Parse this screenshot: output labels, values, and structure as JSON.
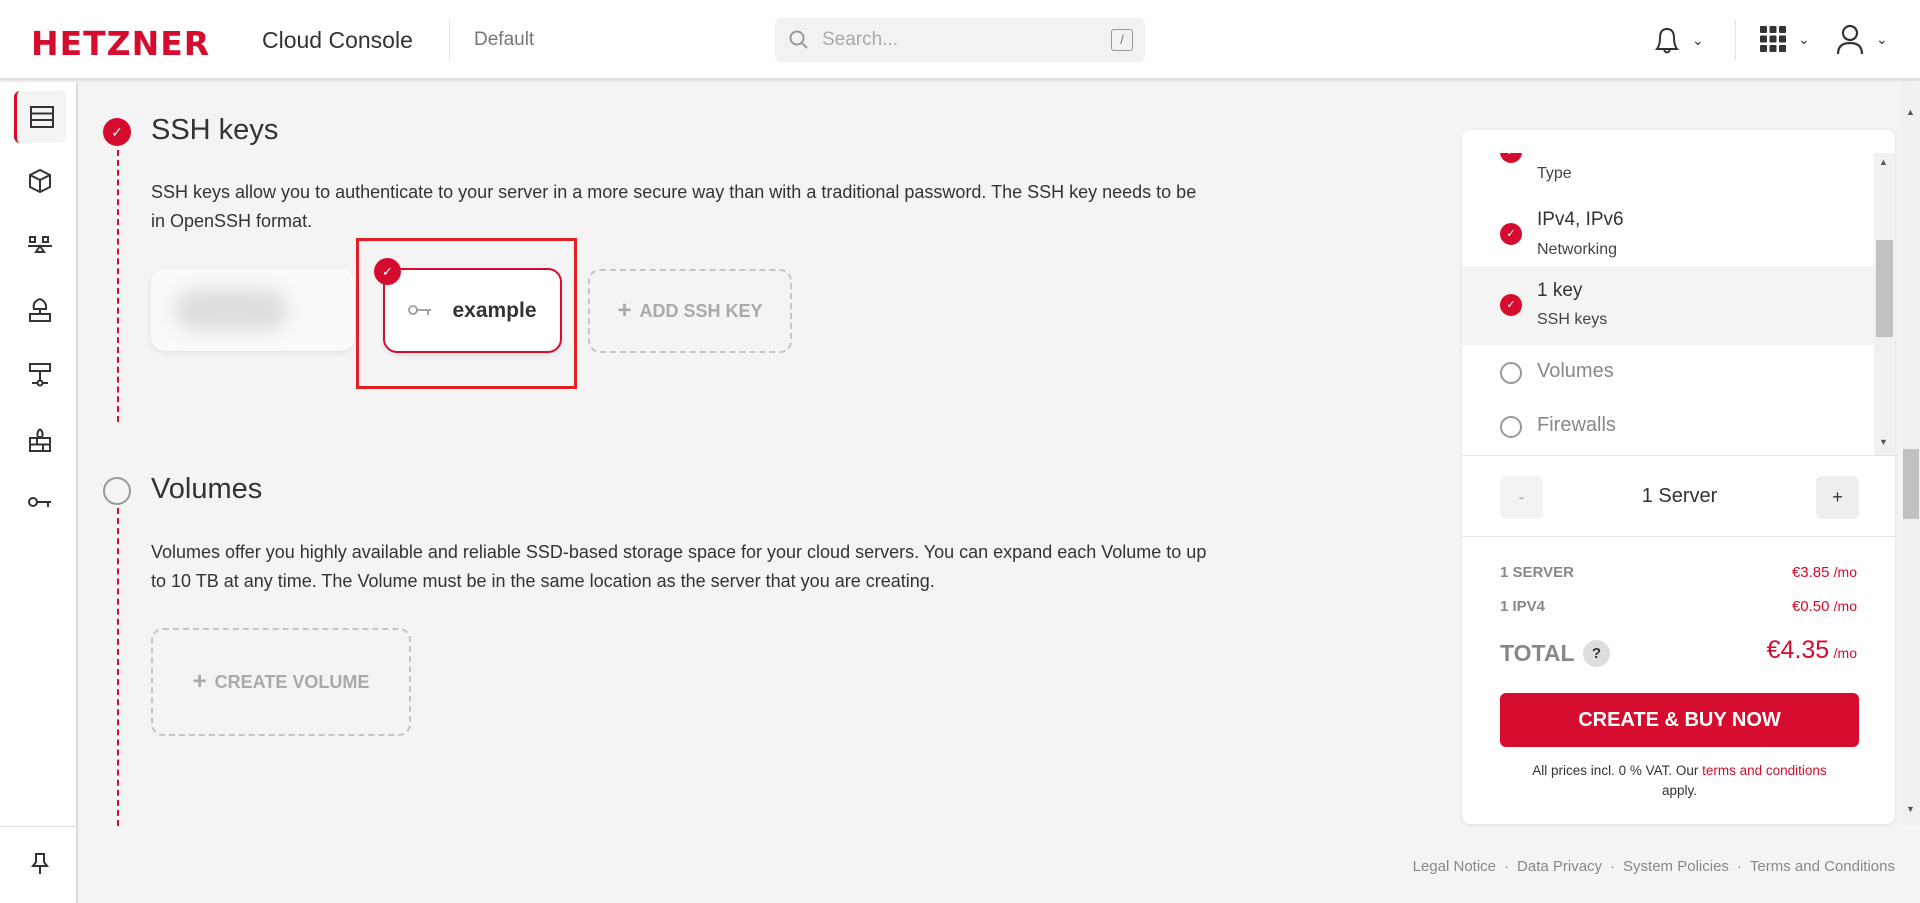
{
  "header": {
    "logo": "HETZNER",
    "app_title": "Cloud Console",
    "project": "Default",
    "search_placeholder": "Search...",
    "search_shortcut": "/"
  },
  "sidebar": {
    "items": [
      "servers",
      "volumes",
      "load-balancers",
      "floating-ips",
      "networks",
      "firewalls",
      "ssh-keys"
    ],
    "pin": "pin"
  },
  "ssh": {
    "title": "SSH keys",
    "description": "SSH keys allow you to authenticate to your server in a more secure way than with a traditional password. The SSH key needs to be in OpenSSH format.",
    "selected_key": "example",
    "add_label": "ADD SSH KEY"
  },
  "volumes": {
    "title": "Volumes",
    "description": "Volumes offer you highly available and reliable SSD-based storage space for your cloud servers. You can expand each Volume to up to 10 TB at any time. The Volume must be in the same location as the server that you are creating.",
    "create_label": "CREATE VOLUME"
  },
  "summary": {
    "steps": [
      {
        "value": "",
        "label": "Type",
        "done": true
      },
      {
        "value": "IPv4, IPv6",
        "label": "Networking",
        "done": true
      },
      {
        "value": "1 key",
        "label": "SSH keys",
        "done": true
      },
      {
        "value": "Volumes",
        "done": false
      },
      {
        "value": "Firewalls",
        "done": false
      }
    ],
    "minus": "-",
    "plus": "+",
    "server_count": "1 Server",
    "lines": [
      {
        "label": "1 SERVER",
        "price": "€3.85",
        "unit": "/mo"
      },
      {
        "label": "1 IPV4",
        "price": "€0.50",
        "unit": "/mo"
      }
    ],
    "total_label": "TOTAL",
    "help": "?",
    "total": "€4.35",
    "total_unit": "/mo",
    "buy": "CREATE & BUY NOW",
    "note_pre": "All prices incl. 0 % VAT. Our ",
    "note_link": "terms and conditions",
    "note_post": "apply."
  },
  "footer": [
    "Legal Notice",
    "Data Privacy",
    "System Policies",
    "Terms and Conditions"
  ],
  "colors": {
    "accent": "#d50c2d"
  }
}
